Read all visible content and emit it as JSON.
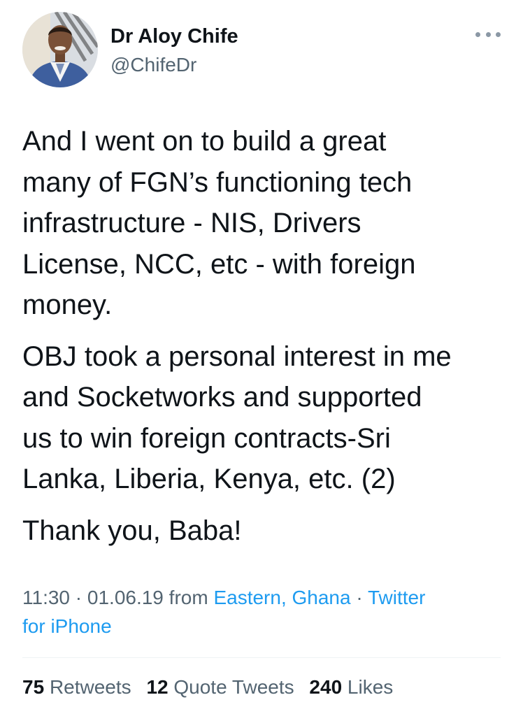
{
  "user": {
    "display_name": "Dr Aloy Chife",
    "handle": "@ChifeDr",
    "avatar_icon": "profile-photo"
  },
  "more_menu_icon": "more-horizontal-icon",
  "tweet": {
    "paragraphs": [
      {
        "lines": [
          "And I went on to build a great",
          "many of FGN’s functioning tech",
          "infrastructure - NIS, Drivers",
          "License, NCC, etc - with foreign",
          "money."
        ]
      },
      {
        "lines": [
          "OBJ took a personal interest in me",
          "and Socketworks and supported",
          "us to win foreign contracts-Sri",
          "Lanka, Liberia, Kenya, etc. (2)"
        ]
      },
      {
        "lines": [
          "Thank you, Baba!"
        ]
      }
    ]
  },
  "meta": {
    "time": "11:30",
    "date": "01.06.19",
    "from_label": "from",
    "location": "Eastern, Ghana",
    "source_part1": "Twitter",
    "source_part2": "for iPhone"
  },
  "stats": {
    "retweets_count": "75",
    "retweets_label": "Retweets",
    "quote_count": "12",
    "quote_label": "Quote Tweets",
    "likes_count": "240",
    "likes_label": "Likes"
  },
  "colors": {
    "text_primary": "#0f1419",
    "text_secondary": "#536471",
    "link": "#1d9bf0",
    "divider": "#eff3f4"
  }
}
